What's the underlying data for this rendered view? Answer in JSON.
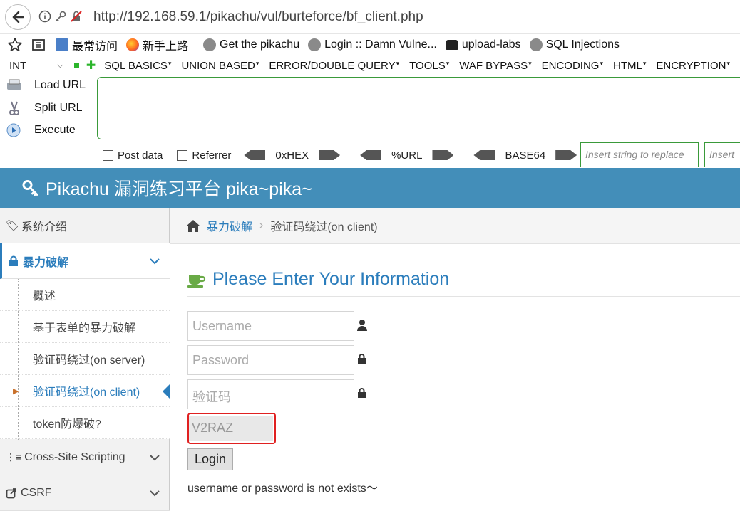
{
  "browser": {
    "url": "http://192.168.59.1/pikachu/vul/burteforce/bf_client.php"
  },
  "bookmarks": [
    {
      "label": "最常访问",
      "icon": "history-icon"
    },
    {
      "label": "新手上路",
      "icon": "firefox-icon"
    },
    {
      "label": "Get the pikachu",
      "icon": "globe-icon"
    },
    {
      "label": "Login :: Damn Vulne...",
      "icon": "globe-icon"
    },
    {
      "label": "upload-labs",
      "icon": "car-icon"
    },
    {
      "label": "SQL Injections",
      "icon": "globe-icon"
    }
  ],
  "hackbar": {
    "type_select": "INT",
    "menus": [
      "SQL BASICS",
      "UNION BASED",
      "ERROR/DOUBLE QUERY",
      "TOOLS",
      "WAF BYPASS",
      "ENCODING",
      "HTML",
      "ENCRYPTION"
    ],
    "load_url": "Load URL",
    "split_url": "Split URL",
    "execute": "Execute",
    "post_data": "Post data",
    "referrer": "Referrer",
    "hex": "0xHEX",
    "url_enc": "%URL",
    "base64": "BASE64",
    "replace_placeholder": "Insert string to replace",
    "replace_with_placeholder": "Insert"
  },
  "site": {
    "title": "Pikachu 漏洞练习平台 pika~pika~"
  },
  "sidebar": {
    "items": [
      {
        "label": "系统介绍"
      },
      {
        "label": "暴力破解"
      },
      {
        "label": "Cross-Site Scripting"
      },
      {
        "label": "CSRF"
      }
    ],
    "subitems": [
      {
        "label": "概述"
      },
      {
        "label": "基于表单的暴力破解"
      },
      {
        "label": "验证码绕过(on server)"
      },
      {
        "label": "验证码绕过(on client)"
      },
      {
        "label": "token防爆破?"
      }
    ]
  },
  "breadcrumb": {
    "section": "暴力破解",
    "current": "验证码绕过(on client)"
  },
  "form": {
    "title": "Please Enter Your Information",
    "username_placeholder": "Username",
    "password_placeholder": "Password",
    "captcha_placeholder": "验证码",
    "captcha_value": "V2RAZ",
    "login_label": "Login",
    "message": "username or password is not exists～"
  },
  "colors": {
    "header_bg": "#438eb9",
    "accent": "#2b7dbc",
    "highlight_border": "#e02020",
    "hackbar_green": "#3a9a3a"
  }
}
